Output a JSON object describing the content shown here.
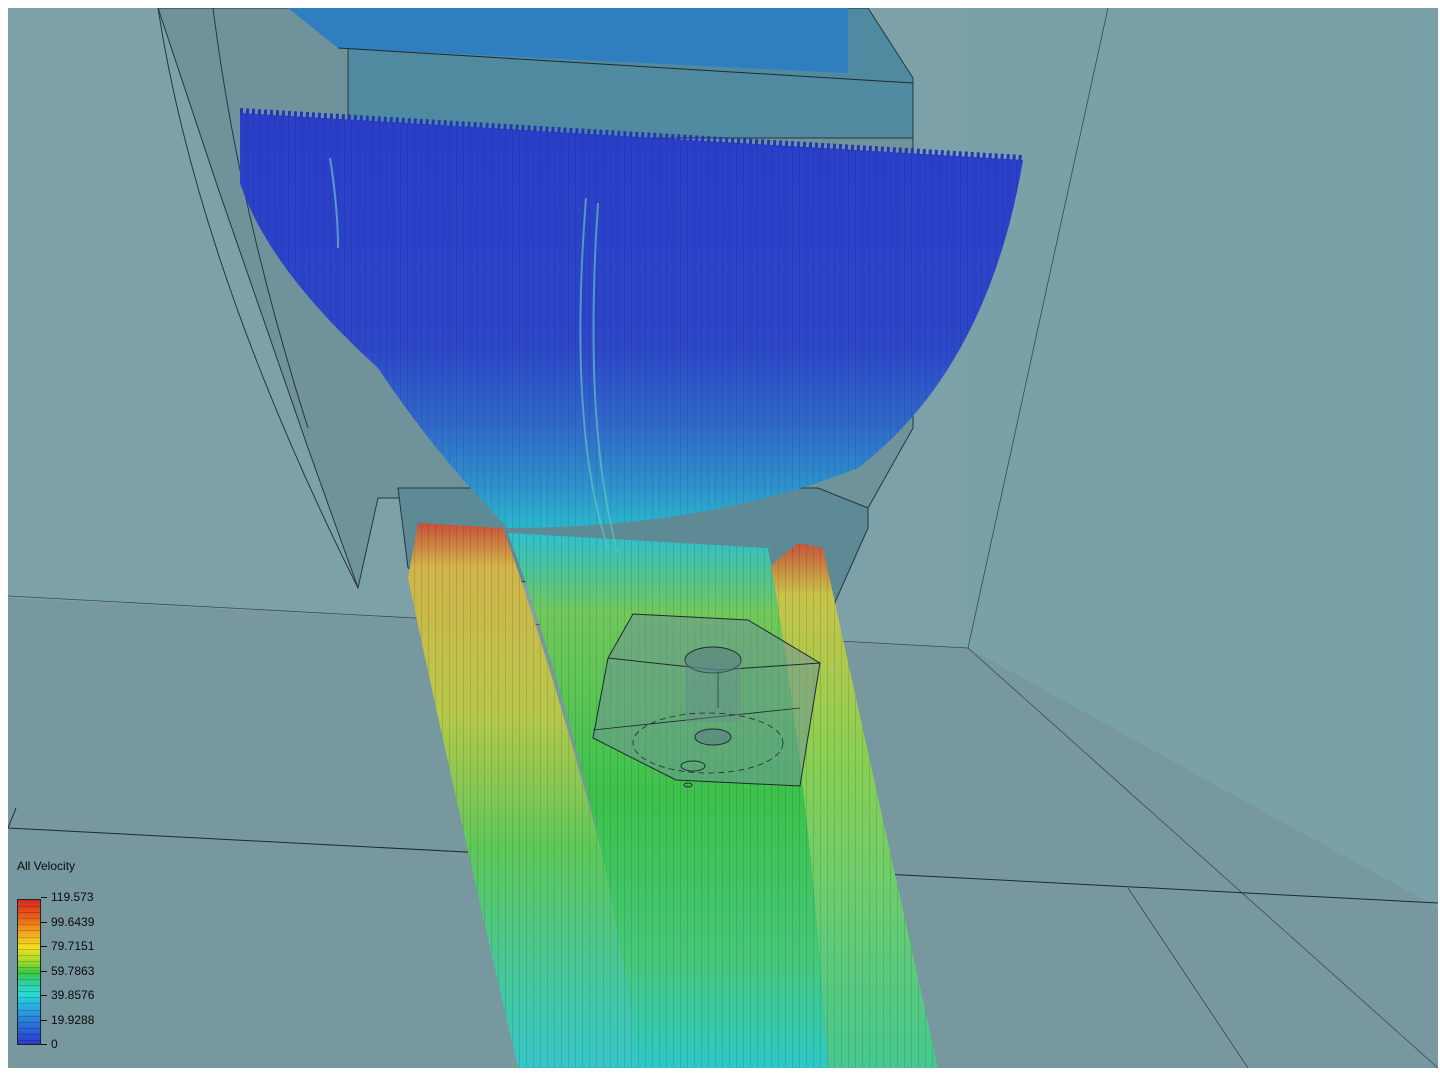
{
  "legend": {
    "title": "All Velocity",
    "ticks": [
      "119.573",
      "99.6439",
      "79.7151",
      "59.7863",
      "39.8576",
      "19.9288",
      "0"
    ],
    "colors": [
      "#d42a1e",
      "#e8601a",
      "#eede22",
      "#3ec83c",
      "#2ad8d8",
      "#2a78d8",
      "#2a3ad0"
    ]
  },
  "scene": {
    "background_color": "#7da1a9",
    "inlet_stream_color": "#2b3fc6",
    "outlet_stream_colors": [
      "#2ac8d0",
      "#3ec83c",
      "#d2d24a",
      "#d24a2a"
    ]
  }
}
